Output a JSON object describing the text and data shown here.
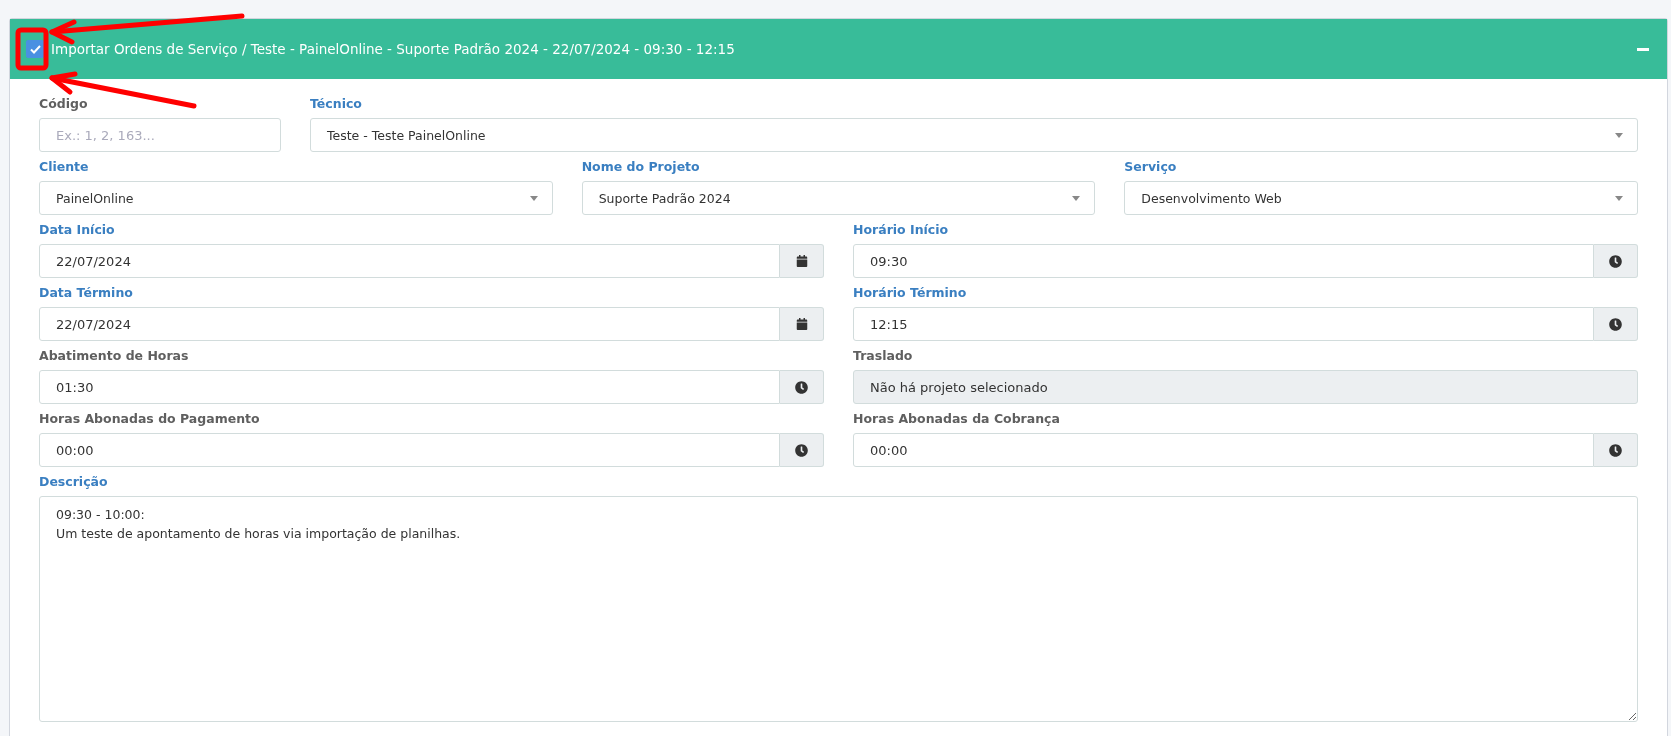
{
  "panel": {
    "title": "Importar Ordens de Serviço / Teste - PainelOnline - Suporte Padrão 2024 - 22/07/2024 - 09:30 - 12:15",
    "checked": true,
    "expanded": true,
    "rows": [
      {
        "fields": [
          {
            "label": "Código",
            "required": false,
            "kind": "text",
            "placeholder": "Ex.: 1, 2, 163..."
          },
          {
            "label": "Técnico",
            "required": true,
            "kind": "select",
            "value": "Teste - Teste PainelOnline"
          }
        ]
      },
      {
        "fields": [
          {
            "label": "Cliente",
            "required": true,
            "kind": "select",
            "value": "PainelOnline"
          },
          {
            "label": "Nome do Projeto",
            "required": true,
            "kind": "select",
            "value": "Suporte Padrão 2024"
          },
          {
            "label": "Serviço",
            "required": true,
            "kind": "select",
            "value": "Desenvolvimento Web"
          }
        ]
      },
      {
        "fields": [
          {
            "label": "Data Início",
            "required": true,
            "kind": "date",
            "value": "22/07/2024"
          },
          {
            "label": "Horário Início",
            "required": true,
            "kind": "time",
            "value": "09:30"
          }
        ]
      },
      {
        "fields": [
          {
            "label": "Data Término",
            "required": true,
            "kind": "date",
            "value": "22/07/2024"
          },
          {
            "label": "Horário Término",
            "required": true,
            "kind": "time",
            "value": "12:15"
          }
        ]
      },
      {
        "fields": [
          {
            "label": "Abatimento de Horas",
            "required": false,
            "kind": "time",
            "value": "01:30"
          },
          {
            "label": "Traslado",
            "required": false,
            "kind": "readonly",
            "value": "Não há projeto selecionado"
          }
        ]
      },
      {
        "fields": [
          {
            "label": "Horas Abonadas do Pagamento",
            "required": false,
            "kind": "time",
            "value": "00:00"
          },
          {
            "label": "Horas Abonadas da Cobrança",
            "required": false,
            "kind": "time",
            "value": "00:00"
          }
        ]
      }
    ],
    "description": {
      "label": "Descrição",
      "required": true,
      "value": "09:30 - 10:00:\nUm teste de apontamento de horas via importação de planilhas."
    }
  }
}
